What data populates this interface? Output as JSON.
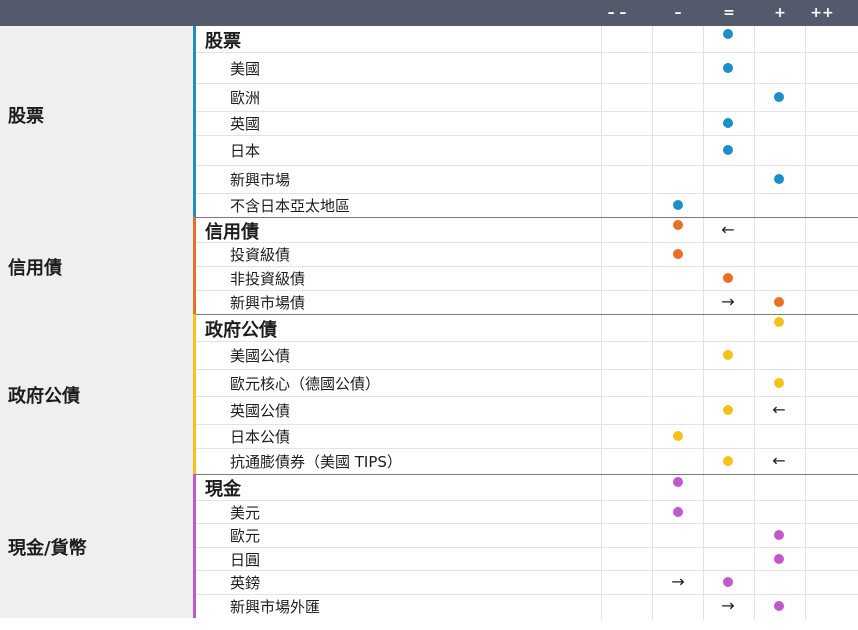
{
  "columns": [
    "– –",
    "–",
    "=",
    "+",
    "++"
  ],
  "colors": {
    "equities": "#1a8fc9",
    "credit": "#ea6e23",
    "government": "#f6c21a",
    "cash": "#c158cc"
  },
  "groups": [
    {
      "label": "股票",
      "color_key": "equities",
      "rows": [
        {
          "label": "股票",
          "heading": true,
          "dot": 2
        },
        {
          "label": "美國",
          "dot": 2
        },
        {
          "label": "歐洲",
          "dot": 3
        },
        {
          "label": "英國",
          "dot": 2
        },
        {
          "label": "日本",
          "dot": 2
        },
        {
          "label": "新興市場",
          "dot": 3
        },
        {
          "label": "不含日本亞太地區",
          "dot": 1
        }
      ]
    },
    {
      "label": "信用債",
      "color_key": "credit",
      "rows": [
        {
          "label": "信用債",
          "heading": true,
          "dot": 1,
          "arrow": {
            "col": 2,
            "dir": "left"
          }
        },
        {
          "label": "投資級債",
          "dot": 1
        },
        {
          "label": "非投資級債",
          "dot": 2
        },
        {
          "label": "新興市場債",
          "dot": 3,
          "arrow": {
            "col": 2,
            "dir": "right"
          }
        }
      ]
    },
    {
      "label": "政府公債",
      "color_key": "government",
      "rows": [
        {
          "label": "政府公債",
          "heading": true,
          "dot": 3
        },
        {
          "label": "美國公債",
          "dot": 2
        },
        {
          "label": "歐元核心（德國公債）",
          "dot": 3
        },
        {
          "label": "英國公債",
          "dot": 2,
          "arrow": {
            "col": 3,
            "dir": "left"
          }
        },
        {
          "label": "日本公債",
          "dot": 1
        },
        {
          "label": "抗通膨債券（美國 TIPS）",
          "dot": 2,
          "arrow": {
            "col": 3,
            "dir": "left"
          }
        }
      ]
    },
    {
      "label": "現金/貨幣",
      "color_key": "cash",
      "rows": [
        {
          "label": "現金",
          "heading": true,
          "dot": 1
        },
        {
          "label": "美元",
          "dot": 1
        },
        {
          "label": "歐元",
          "dot": 3
        },
        {
          "label": "日圓",
          "dot": 3
        },
        {
          "label": "英鎊",
          "dot": 2,
          "arrow": {
            "col": 1,
            "dir": "right"
          }
        },
        {
          "label": "新興市場外匯",
          "dot": 3,
          "arrow": {
            "col": 2,
            "dir": "right"
          }
        }
      ]
    }
  ],
  "icons": {
    "left": "left-arrow-icon",
    "right": "right-arrow-icon"
  }
}
